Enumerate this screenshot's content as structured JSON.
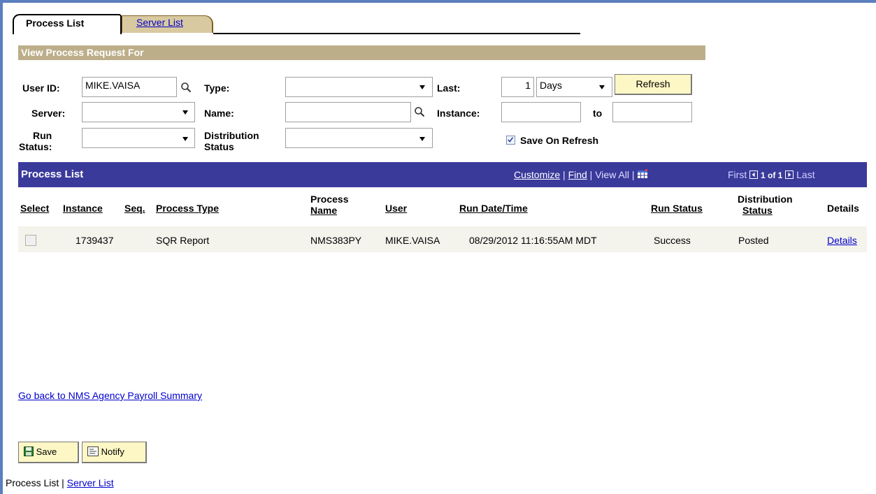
{
  "tabs": {
    "active": "Process List",
    "inactive": "Server List"
  },
  "filter": {
    "header": "View Process Request For",
    "user_id_label": "User ID:",
    "user_id_value": "MIKE.VAISA",
    "type_label": "Type:",
    "type_value": "",
    "last_label": "Last:",
    "last_value": "1",
    "last_unit": "Days",
    "refresh": "Refresh",
    "server_label": "Server:",
    "server_value": "",
    "name_label": "Name:",
    "name_value": "",
    "instance_label": "Instance:",
    "instance_from": "",
    "to_label": "to",
    "instance_to": "",
    "run_status_label_1": "Run",
    "run_status_label_2": "Status:",
    "run_status_value": "",
    "dist_status_label_1": "Distribution",
    "dist_status_label_2": "Status",
    "dist_status_value": "",
    "save_on_refresh": "Save On Refresh",
    "save_on_refresh_checked": true
  },
  "grid": {
    "title": "Process List",
    "customize": "Customize",
    "find": "Find",
    "view_all": "View All",
    "first": "First",
    "page": "1 of 1",
    "last": "Last",
    "headers": {
      "select": "Select",
      "instance": "Instance",
      "seq": "Seq.",
      "process_type": "Process Type",
      "process_name_1": "Process",
      "process_name_2": "Name",
      "user": "User",
      "run_date": "Run Date/Time",
      "run_status": "Run Status",
      "dist_status_1": "Distribution",
      "dist_status_2": "Status",
      "details": "Details"
    },
    "rows": [
      {
        "instance": "1739437",
        "seq": "",
        "process_type": "SQR Report",
        "process_name": "NMS383PY",
        "user": "MIKE.VAISA",
        "run_date": "08/29/2012 11:16:55AM MDT",
        "run_status": "Success",
        "dist_status": "Posted",
        "details": "Details"
      }
    ]
  },
  "go_back_link": "Go back to NMS Agency Payroll Summary",
  "buttons": {
    "save": "Save",
    "notify": "Notify"
  },
  "footer": {
    "process_list": "Process List",
    "separator": " | ",
    "server_list": "Server List"
  }
}
